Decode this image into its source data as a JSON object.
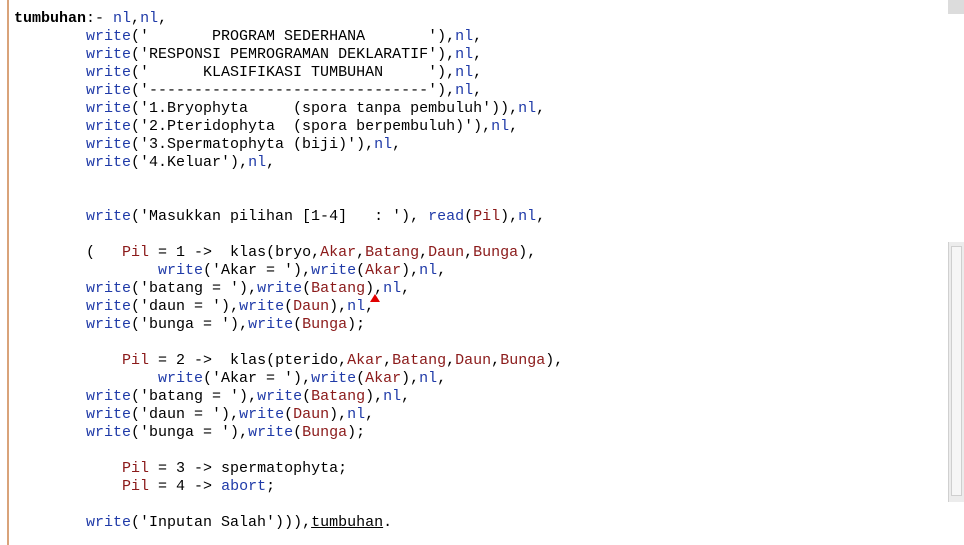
{
  "editor": {
    "lines": [
      [
        {
          "c": "b",
          "t": "tumbuhan"
        },
        {
          "c": "t",
          "t": ":- "
        },
        {
          "c": "kw",
          "t": "nl"
        },
        {
          "c": "t",
          "t": ","
        },
        {
          "c": "kw",
          "t": "nl"
        },
        {
          "c": "t",
          "t": ","
        }
      ],
      [
        {
          "c": "t",
          "t": "        "
        },
        {
          "c": "kw",
          "t": "write"
        },
        {
          "c": "t",
          "t": "('       PROGRAM SEDERHANA       ')"
        },
        {
          "c": "t",
          "t": ","
        },
        {
          "c": "kw",
          "t": "nl"
        },
        {
          "c": "t",
          "t": ","
        }
      ],
      [
        {
          "c": "t",
          "t": "        "
        },
        {
          "c": "kw",
          "t": "write"
        },
        {
          "c": "t",
          "t": "('RESPONSI PEMROGRAMAN DEKLARATIF')"
        },
        {
          "c": "t",
          "t": ","
        },
        {
          "c": "kw",
          "t": "nl"
        },
        {
          "c": "t",
          "t": ","
        }
      ],
      [
        {
          "c": "t",
          "t": "        "
        },
        {
          "c": "kw",
          "t": "write"
        },
        {
          "c": "t",
          "t": "('      KLASIFIKASI TUMBUHAN     ')"
        },
        {
          "c": "t",
          "t": ","
        },
        {
          "c": "kw",
          "t": "nl"
        },
        {
          "c": "t",
          "t": ","
        }
      ],
      [
        {
          "c": "t",
          "t": "        "
        },
        {
          "c": "kw",
          "t": "write"
        },
        {
          "c": "t",
          "t": "('-------------------------------')"
        },
        {
          "c": "t",
          "t": ","
        },
        {
          "c": "kw",
          "t": "nl"
        },
        {
          "c": "t",
          "t": ","
        }
      ],
      [
        {
          "c": "t",
          "t": "        "
        },
        {
          "c": "kw",
          "t": "write"
        },
        {
          "c": "t",
          "t": "('1.Bryophyta     (spora tanpa pembuluh')"
        },
        {
          "c": "t",
          "t": ")"
        },
        {
          "c": "t",
          "t": ","
        },
        {
          "c": "kw",
          "t": "nl"
        },
        {
          "c": "t",
          "t": ","
        }
      ],
      [
        {
          "c": "t",
          "t": "        "
        },
        {
          "c": "kw",
          "t": "write"
        },
        {
          "c": "t",
          "t": "('2.Pteridophyta  (spora berpembuluh)')"
        },
        {
          "c": "t",
          "t": ","
        },
        {
          "c": "kw",
          "t": "nl"
        },
        {
          "c": "t",
          "t": ","
        }
      ],
      [
        {
          "c": "t",
          "t": "        "
        },
        {
          "c": "kw",
          "t": "write"
        },
        {
          "c": "t",
          "t": "('3.Spermatophyta (biji)')"
        },
        {
          "c": "t",
          "t": ","
        },
        {
          "c": "kw",
          "t": "nl"
        },
        {
          "c": "t",
          "t": ","
        }
      ],
      [
        {
          "c": "t",
          "t": "        "
        },
        {
          "c": "kw",
          "t": "write"
        },
        {
          "c": "t",
          "t": "('4.Keluar')"
        },
        {
          "c": "t",
          "t": ","
        },
        {
          "c": "kw",
          "t": "nl"
        },
        {
          "c": "t",
          "t": ","
        }
      ],
      [],
      [],
      [
        {
          "c": "t",
          "t": "        "
        },
        {
          "c": "kw",
          "t": "write"
        },
        {
          "c": "t",
          "t": "('Masukkan pilihan [1-4]   : ')"
        },
        {
          "c": "t",
          "t": ", "
        },
        {
          "c": "kw",
          "t": "read"
        },
        {
          "c": "t",
          "t": "("
        },
        {
          "c": "va",
          "t": "Pil"
        },
        {
          "c": "t",
          "t": ")"
        },
        {
          "c": "t",
          "t": ","
        },
        {
          "c": "kw",
          "t": "nl"
        },
        {
          "c": "t",
          "t": ","
        }
      ],
      [],
      [
        {
          "c": "t",
          "t": "        (   "
        },
        {
          "c": "va",
          "t": "Pil"
        },
        {
          "c": "t",
          "t": " = 1 ->  klas(bryo,"
        },
        {
          "c": "va",
          "t": "Akar"
        },
        {
          "c": "t",
          "t": ","
        },
        {
          "c": "va",
          "t": "Batang"
        },
        {
          "c": "t",
          "t": ","
        },
        {
          "c": "va",
          "t": "Daun"
        },
        {
          "c": "t",
          "t": ","
        },
        {
          "c": "va",
          "t": "Bunga"
        },
        {
          "c": "t",
          "t": "),"
        }
      ],
      [
        {
          "c": "t",
          "t": "                "
        },
        {
          "c": "kw",
          "t": "write"
        },
        {
          "c": "t",
          "t": "('Akar = ')"
        },
        {
          "c": "t",
          "t": ","
        },
        {
          "c": "kw",
          "t": "write"
        },
        {
          "c": "t",
          "t": "("
        },
        {
          "c": "va",
          "t": "Akar"
        },
        {
          "c": "t",
          "t": ")"
        },
        {
          "c": "t",
          "t": ","
        },
        {
          "c": "kw",
          "t": "nl"
        },
        {
          "c": "t",
          "t": ","
        }
      ],
      [
        {
          "c": "t",
          "t": "        "
        },
        {
          "c": "kw",
          "t": "write"
        },
        {
          "c": "t",
          "t": "('batang = ')"
        },
        {
          "c": "t",
          "t": ","
        },
        {
          "c": "kw",
          "t": "write"
        },
        {
          "c": "t",
          "t": "("
        },
        {
          "c": "va",
          "t": "Batang"
        },
        {
          "c": "t",
          "t": ")"
        },
        {
          "c": "t",
          "t": ","
        },
        {
          "c": "kw",
          "t": "nl"
        },
        {
          "c": "t",
          "t": ","
        }
      ],
      [
        {
          "c": "t",
          "t": "        "
        },
        {
          "c": "kw",
          "t": "write"
        },
        {
          "c": "t",
          "t": "('daun = ')"
        },
        {
          "c": "t",
          "t": ","
        },
        {
          "c": "kw",
          "t": "write"
        },
        {
          "c": "t",
          "t": "("
        },
        {
          "c": "va",
          "t": "Daun"
        },
        {
          "c": "t",
          "t": ")"
        },
        {
          "c": "t",
          "t": ","
        },
        {
          "c": "kw",
          "t": "nl"
        },
        {
          "c": "t",
          "t": ","
        }
      ],
      [
        {
          "c": "t",
          "t": "        "
        },
        {
          "c": "kw",
          "t": "write"
        },
        {
          "c": "t",
          "t": "('bunga = ')"
        },
        {
          "c": "t",
          "t": ","
        },
        {
          "c": "kw",
          "t": "write"
        },
        {
          "c": "t",
          "t": "("
        },
        {
          "c": "va",
          "t": "Bunga"
        },
        {
          "c": "t",
          "t": ")"
        },
        {
          "c": "t",
          "t": ";"
        }
      ],
      [],
      [
        {
          "c": "t",
          "t": "            "
        },
        {
          "c": "va",
          "t": "Pil"
        },
        {
          "c": "t",
          "t": " = 2 ->  klas(pterido,"
        },
        {
          "c": "va",
          "t": "Akar"
        },
        {
          "c": "t",
          "t": ","
        },
        {
          "c": "va",
          "t": "Batang"
        },
        {
          "c": "t",
          "t": ","
        },
        {
          "c": "va",
          "t": "Daun"
        },
        {
          "c": "t",
          "t": ","
        },
        {
          "c": "va",
          "t": "Bunga"
        },
        {
          "c": "t",
          "t": "),"
        }
      ],
      [
        {
          "c": "t",
          "t": "                "
        },
        {
          "c": "kw",
          "t": "write"
        },
        {
          "c": "t",
          "t": "('Akar = ')"
        },
        {
          "c": "t",
          "t": ","
        },
        {
          "c": "kw",
          "t": "write"
        },
        {
          "c": "t",
          "t": "("
        },
        {
          "c": "va",
          "t": "Akar"
        },
        {
          "c": "t",
          "t": ")"
        },
        {
          "c": "t",
          "t": ","
        },
        {
          "c": "kw",
          "t": "nl"
        },
        {
          "c": "t",
          "t": ","
        }
      ],
      [
        {
          "c": "t",
          "t": "        "
        },
        {
          "c": "kw",
          "t": "write"
        },
        {
          "c": "t",
          "t": "('batang = ')"
        },
        {
          "c": "t",
          "t": ","
        },
        {
          "c": "kw",
          "t": "write"
        },
        {
          "c": "t",
          "t": "("
        },
        {
          "c": "va",
          "t": "Batang"
        },
        {
          "c": "t",
          "t": ")"
        },
        {
          "c": "t",
          "t": ","
        },
        {
          "c": "kw",
          "t": "nl"
        },
        {
          "c": "t",
          "t": ","
        }
      ],
      [
        {
          "c": "t",
          "t": "        "
        },
        {
          "c": "kw",
          "t": "write"
        },
        {
          "c": "t",
          "t": "('daun = ')"
        },
        {
          "c": "t",
          "t": ","
        },
        {
          "c": "kw",
          "t": "write"
        },
        {
          "c": "t",
          "t": "("
        },
        {
          "c": "va",
          "t": "Daun"
        },
        {
          "c": "t",
          "t": ")"
        },
        {
          "c": "t",
          "t": ","
        },
        {
          "c": "kw",
          "t": "nl"
        },
        {
          "c": "t",
          "t": ","
        }
      ],
      [
        {
          "c": "t",
          "t": "        "
        },
        {
          "c": "kw",
          "t": "write"
        },
        {
          "c": "t",
          "t": "('bunga = ')"
        },
        {
          "c": "t",
          "t": ","
        },
        {
          "c": "kw",
          "t": "write"
        },
        {
          "c": "t",
          "t": "("
        },
        {
          "c": "va",
          "t": "Bunga"
        },
        {
          "c": "t",
          "t": ")"
        },
        {
          "c": "t",
          "t": ";"
        }
      ],
      [],
      [
        {
          "c": "t",
          "t": "            "
        },
        {
          "c": "va",
          "t": "Pil"
        },
        {
          "c": "t",
          "t": " = 3 -> spermatophyta;"
        }
      ],
      [
        {
          "c": "t",
          "t": "            "
        },
        {
          "c": "va",
          "t": "Pil"
        },
        {
          "c": "t",
          "t": " = 4 -> "
        },
        {
          "c": "kw",
          "t": "abort"
        },
        {
          "c": "t",
          "t": ";"
        }
      ],
      [],
      [
        {
          "c": "t",
          "t": "        "
        },
        {
          "c": "kw",
          "t": "write"
        },
        {
          "c": "t",
          "t": "('Inputan Salah')"
        },
        {
          "c": "t",
          "t": "))"
        },
        {
          "c": "t",
          "t": ","
        },
        {
          "c": "u",
          "t": "tumbuhan"
        },
        {
          "c": "t",
          "t": "."
        }
      ]
    ]
  },
  "colors": {
    "keyword": "#1f3aa8",
    "variable": "#8b1a1a",
    "text": "#000000",
    "gutter_line": "#d9a37a",
    "error_marker": "#e00000"
  },
  "icons": {
    "error_marker": "error-triangle-icon"
  }
}
